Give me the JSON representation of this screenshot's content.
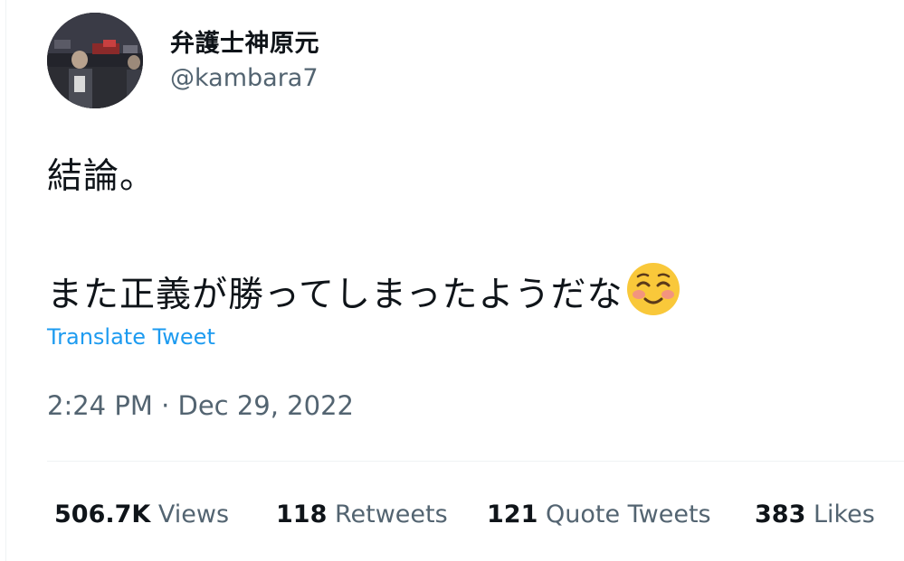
{
  "author": {
    "display_name": "弁護士神原元",
    "handle": "@kambara7"
  },
  "tweet": {
    "line1": "結論。",
    "line2": "また正義が勝ってしまったようだな",
    "emoji": "smiling-face-with-blush-icon",
    "translate_label": "Translate Tweet",
    "timestamp": "2:24 PM · Dec 29, 2022"
  },
  "stats": {
    "views_count": "506.7K",
    "views_label": "Views",
    "retweets_count": "118",
    "retweets_label": "Retweets",
    "quotes_count": "121",
    "quotes_label": "Quote Tweets",
    "likes_count": "383",
    "likes_label": "Likes"
  },
  "colors": {
    "text_primary": "#0f1419",
    "text_secondary": "#536471",
    "link": "#1d9bf0",
    "divider": "#eff3f4",
    "emoji_face": "#f9c83a",
    "emoji_blush": "#f28b8b"
  }
}
